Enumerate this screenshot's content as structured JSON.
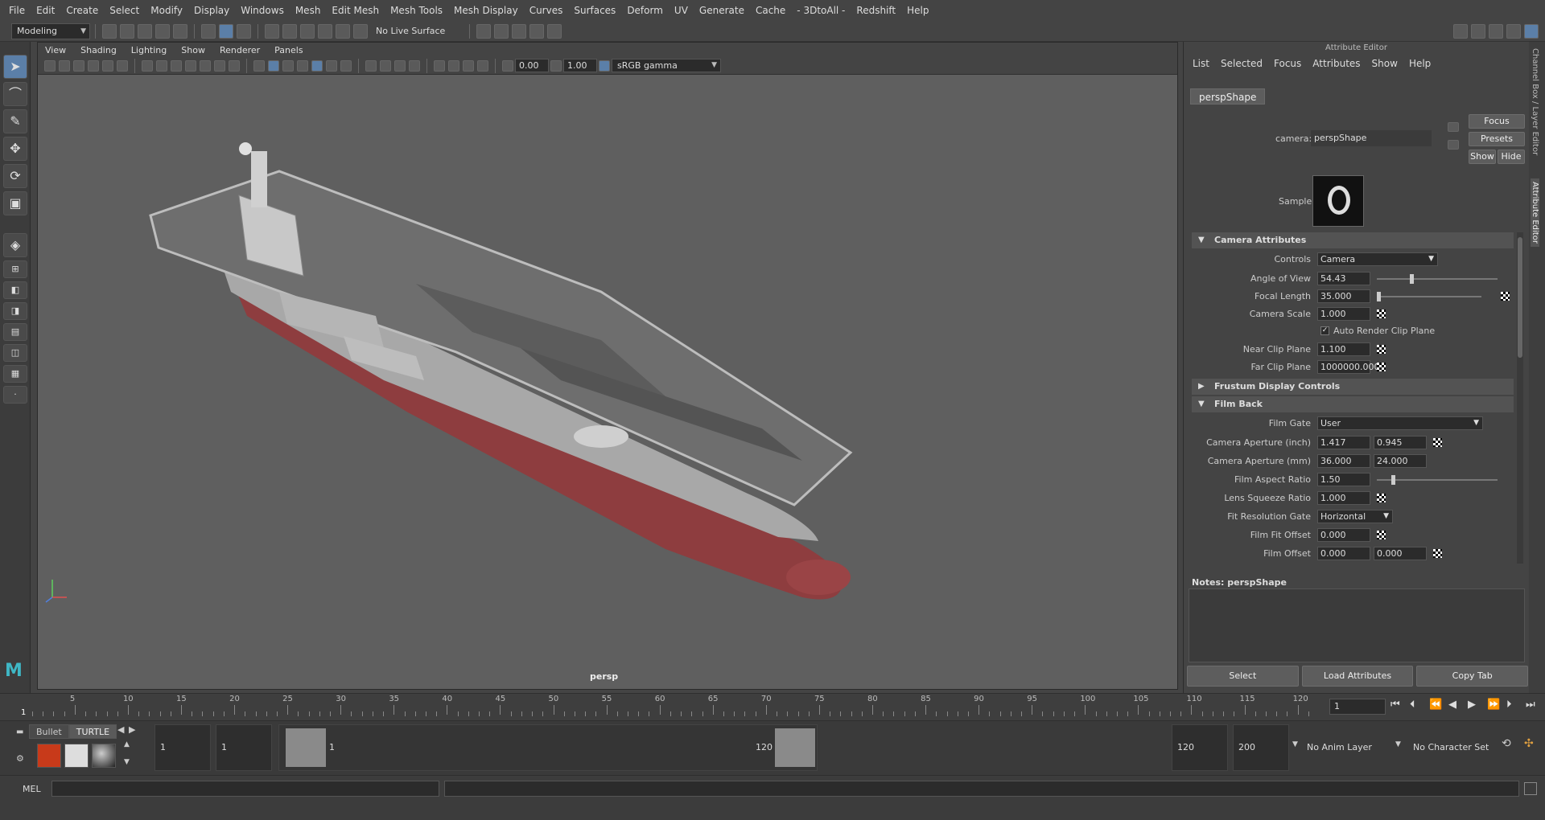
{
  "menubar": {
    "items": [
      "File",
      "Edit",
      "Create",
      "Select",
      "Modify",
      "Display",
      "Windows",
      "Mesh",
      "Edit Mesh",
      "Mesh Tools",
      "Mesh Display",
      "Curves",
      "Surfaces",
      "Deform",
      "UV",
      "Generate",
      "Cache",
      "- 3DtoAll -",
      "Redshift",
      "Help"
    ]
  },
  "statusline": {
    "mode": "Modeling",
    "live_surface": "No Live Surface"
  },
  "viewport": {
    "menu": [
      "View",
      "Shading",
      "Lighting",
      "Show",
      "Renderer",
      "Panels"
    ],
    "exposure": "0.00",
    "gamma": "1.00",
    "colorspace": "sRGB gamma",
    "camera_label": "persp"
  },
  "attribute_editor": {
    "title": "Attribute Editor",
    "menu": [
      "List",
      "Selected",
      "Focus",
      "Attributes",
      "Show",
      "Help"
    ],
    "tab": "perspShape",
    "camera_label": "camera:",
    "camera_name": "perspShape",
    "buttons": {
      "focus": "Focus",
      "presets": "Presets",
      "show": "Show",
      "hide": "Hide"
    },
    "sample_label": "Sample",
    "sections": {
      "camera_attributes": "Camera Attributes",
      "frustum": "Frustum Display Controls",
      "film_back": "Film Back"
    },
    "camera_attrs": {
      "controls_label": "Controls",
      "controls_value": "Camera",
      "aov_label": "Angle of View",
      "aov_value": "54.43",
      "aov_fraction": 0.27,
      "focal_label": "Focal Length",
      "focal_value": "35.000",
      "focal_fraction": 0.0,
      "scale_label": "Camera Scale",
      "scale_value": "1.000",
      "auto_clip_label": "Auto Render Clip Plane",
      "auto_clip_checked": "✓",
      "near_label": "Near Clip Plane",
      "near_value": "1.100",
      "far_label": "Far Clip Plane",
      "far_value": "1000000.000"
    },
    "film_back": {
      "gate_label": "Film Gate",
      "gate_value": "User",
      "ap_in_label": "Camera Aperture (inch)",
      "ap_in_x": "1.417",
      "ap_in_y": "0.945",
      "ap_mm_label": "Camera Aperture (mm)",
      "ap_mm_x": "36.000",
      "ap_mm_y": "24.000",
      "aspect_label": "Film Aspect Ratio",
      "aspect_value": "1.50",
      "aspect_fraction": 0.12,
      "squeeze_label": "Lens Squeeze Ratio",
      "squeeze_value": "1.000",
      "fitgate_label": "Fit Resolution Gate",
      "fitgate_value": "Horizontal",
      "fitoffset_label": "Film Fit Offset",
      "fitoffset_value": "0.000",
      "offset_label": "Film Offset",
      "offset_x": "0.000",
      "offset_y": "0.000"
    },
    "notes_label": "Notes:  perspShape",
    "bottom": {
      "select": "Select",
      "load": "Load Attributes",
      "copy": "Copy Tab"
    }
  },
  "side_tabs": [
    "Channel Box / Layer Editor",
    "Attribute Editor"
  ],
  "timeline": {
    "ticks": [
      "5",
      "10",
      "15",
      "20",
      "25",
      "30",
      "35",
      "40",
      "45",
      "50",
      "55",
      "60",
      "65",
      "70",
      "75",
      "80",
      "85",
      "90",
      "95",
      "100",
      "105",
      "110",
      "115",
      "120"
    ],
    "start_label": "1",
    "current_frame": "1"
  },
  "range": {
    "shelf_tabs": [
      "Bullet",
      "TURTLE"
    ],
    "start": "1",
    "playback_start": "1",
    "slider_start": "1",
    "slider_end": "120",
    "playback_end": "120",
    "end": "200",
    "anim_layer": "No Anim Layer",
    "char_set": "No Character Set"
  },
  "command": {
    "label": "MEL"
  },
  "colors": {
    "accent": "#5b7fa8",
    "hull_red": "#8e3d3f",
    "deck": "#6e6e6e"
  }
}
